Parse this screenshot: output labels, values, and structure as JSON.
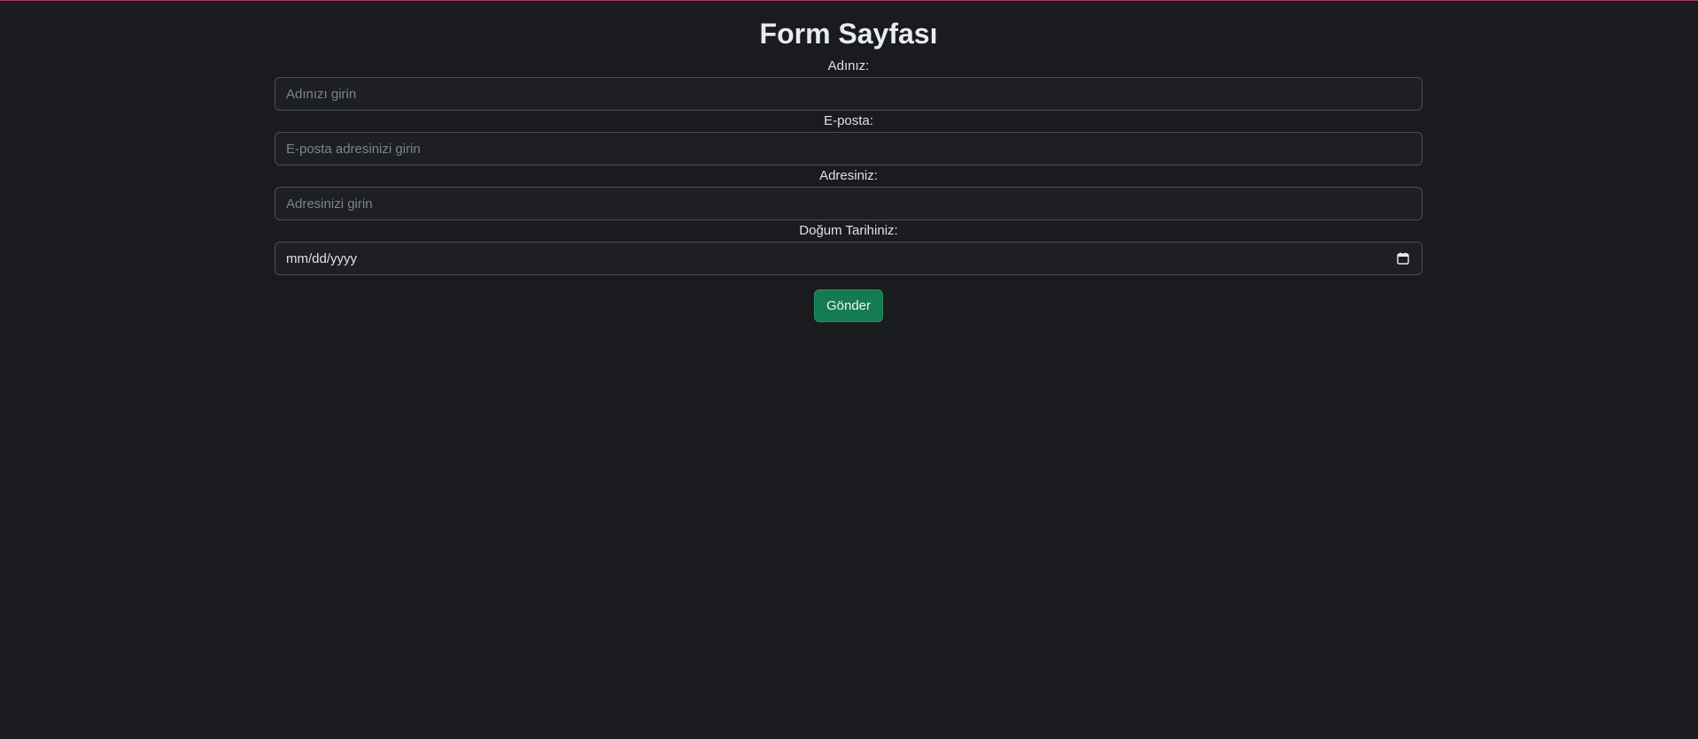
{
  "page": {
    "title": "Form Sayfası"
  },
  "form": {
    "name": {
      "label": "Adınız:",
      "placeholder": "Adınızı girin"
    },
    "email": {
      "label": "E-posta:",
      "placeholder": "E-posta adresinizi girin"
    },
    "address": {
      "label": "Adresiniz:",
      "placeholder": "Adresinizi girin"
    },
    "birthdate": {
      "label": "Doğum Tarihiniz:",
      "value_text": "mm/dd/yyyy",
      "icon": "calendar-icon"
    },
    "submit_label": "Gönder"
  },
  "colors": {
    "background": "#1a1b1e",
    "top_rule": "#b0336a",
    "button": "#147a4f",
    "input_border": "#495057"
  }
}
